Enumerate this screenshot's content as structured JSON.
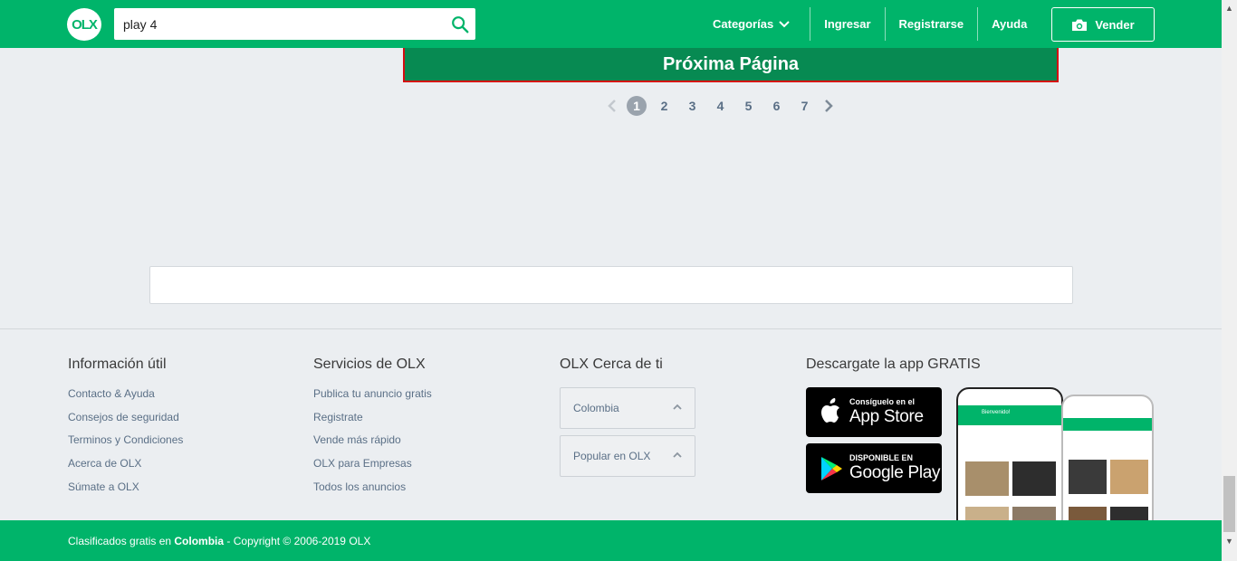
{
  "header": {
    "logo_text": "OLX",
    "search_value": "play 4",
    "nav": {
      "categories": "Categorías",
      "login": "Ingresar",
      "register": "Registrarse",
      "help": "Ayuda"
    },
    "sell_label": "Vender"
  },
  "main": {
    "next_page_label": "Próxima Página",
    "pagination": [
      "1",
      "2",
      "3",
      "4",
      "5",
      "6",
      "7"
    ],
    "current_page": "1"
  },
  "footer": {
    "col1": {
      "title": "Información útil",
      "links": [
        "Contacto & Ayuda",
        "Consejos de seguridad",
        "Terminos y Condiciones",
        "Acerca de OLX",
        "Súmate a OLX"
      ]
    },
    "col2": {
      "title": "Servicios de OLX",
      "links": [
        "Publica tu anuncio gratis",
        "Registrate",
        "Vende más rápido",
        "OLX para Empresas",
        "Todos los anuncios"
      ]
    },
    "col3": {
      "title": "OLX Cerca de ti",
      "accordions": [
        "Colombia",
        "Popular en OLX"
      ]
    },
    "col4": {
      "title": "Descargate la app GRATIS",
      "app_store_small": "Consíguelo en el",
      "app_store_big": "App Store",
      "google_play_small": "DISPONIBLE EN",
      "google_play_big": "Google Play",
      "phone_welcome": "Bienvenido!"
    }
  },
  "bottom_bar": {
    "prefix": "Clasificados gratis en ",
    "country": "Colombia",
    "suffix": " - Copyright © 2006-2019 OLX"
  },
  "colors": {
    "brand_green": "#00b46a",
    "next_page_green": "#078a52",
    "next_page_border": "#d40d12"
  }
}
